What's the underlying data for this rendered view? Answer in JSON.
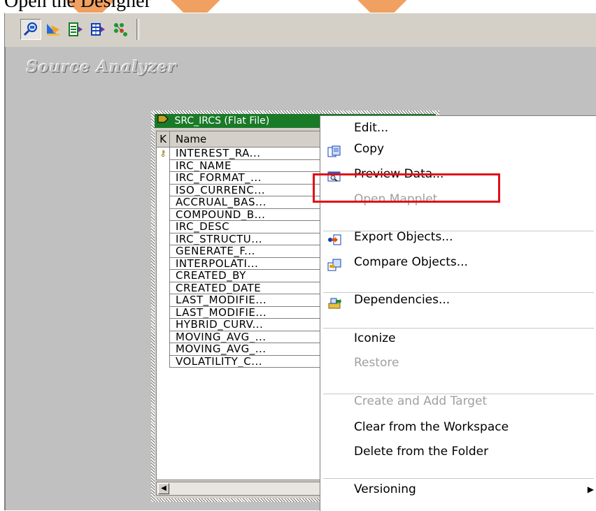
{
  "window": {
    "top_text": "Open the Designer"
  },
  "workspace": {
    "title": "Source Analyzer"
  },
  "toolbar": {
    "buttons": [
      {
        "icon": "source-analyzer-icon",
        "pressed": true
      },
      {
        "icon": "target-designer-icon",
        "pressed": false
      },
      {
        "icon": "transformation-developer-icon",
        "pressed": false
      },
      {
        "icon": "mapplet-designer-icon",
        "pressed": false
      },
      {
        "icon": "mapping-designer-icon",
        "pressed": false
      }
    ]
  },
  "source_definition": {
    "title": "SRC_IRCS (Flat File)",
    "column_key_header": "K",
    "column_name_header": "Name",
    "rows": [
      {
        "key": true,
        "name": "INTEREST_RA..."
      },
      {
        "key": false,
        "name": "IRC_NAME"
      },
      {
        "key": false,
        "name": "IRC_FORMAT_..."
      },
      {
        "key": false,
        "name": "ISO_CURRENC..."
      },
      {
        "key": false,
        "name": "ACCRUAL_BAS..."
      },
      {
        "key": false,
        "name": "COMPOUND_B..."
      },
      {
        "key": false,
        "name": "IRC_DESC"
      },
      {
        "key": false,
        "name": "IRC_STRUCTU..."
      },
      {
        "key": false,
        "name": "GENERATE_F..."
      },
      {
        "key": false,
        "name": "INTERPOLATI..."
      },
      {
        "key": false,
        "name": "CREATED_BY"
      },
      {
        "key": false,
        "name": "CREATED_DATE"
      },
      {
        "key": false,
        "name": "LAST_MODIFIE..."
      },
      {
        "key": false,
        "name": "LAST_MODIFIE..."
      },
      {
        "key": false,
        "name": "HYBRID_CURV..."
      },
      {
        "key": false,
        "name": "MOVING_AVG_..."
      },
      {
        "key": false,
        "name": "MOVING_AVG_..."
      },
      {
        "key": false,
        "name": "VOLATILITY_C..."
      }
    ]
  },
  "context_menu": {
    "items": [
      {
        "label": "Edit...",
        "icon": "",
        "disabled": false
      },
      {
        "label": "Copy",
        "icon": "copy-icon",
        "disabled": false
      },
      {
        "label": "Preview Data...",
        "icon": "preview-data-icon",
        "disabled": false
      },
      {
        "label": "Open Mapplet",
        "icon": "",
        "disabled": true
      },
      {
        "label": "Export Objects...",
        "icon": "export-objects-icon",
        "disabled": false
      },
      {
        "label": "Compare Objects...",
        "icon": "compare-objects-icon",
        "disabled": false
      },
      {
        "label": "Dependencies...",
        "icon": "dependencies-icon",
        "disabled": false
      },
      {
        "label": "Iconize",
        "icon": "",
        "disabled": false
      },
      {
        "label": "Restore",
        "icon": "",
        "disabled": true
      },
      {
        "label": "Create and Add Target",
        "icon": "",
        "disabled": true
      },
      {
        "label": "Clear from the Workspace",
        "icon": "",
        "disabled": false
      },
      {
        "label": "Delete from the Folder",
        "icon": "",
        "disabled": false
      },
      {
        "label": "Versioning",
        "icon": "",
        "disabled": false,
        "submenu": true
      }
    ]
  },
  "colors": {
    "title_bar": "#1a7a28",
    "highlight_outline": "#e01018",
    "workspace_bg": "#c0c0c0",
    "chrome_bg": "#d4d0c8"
  }
}
